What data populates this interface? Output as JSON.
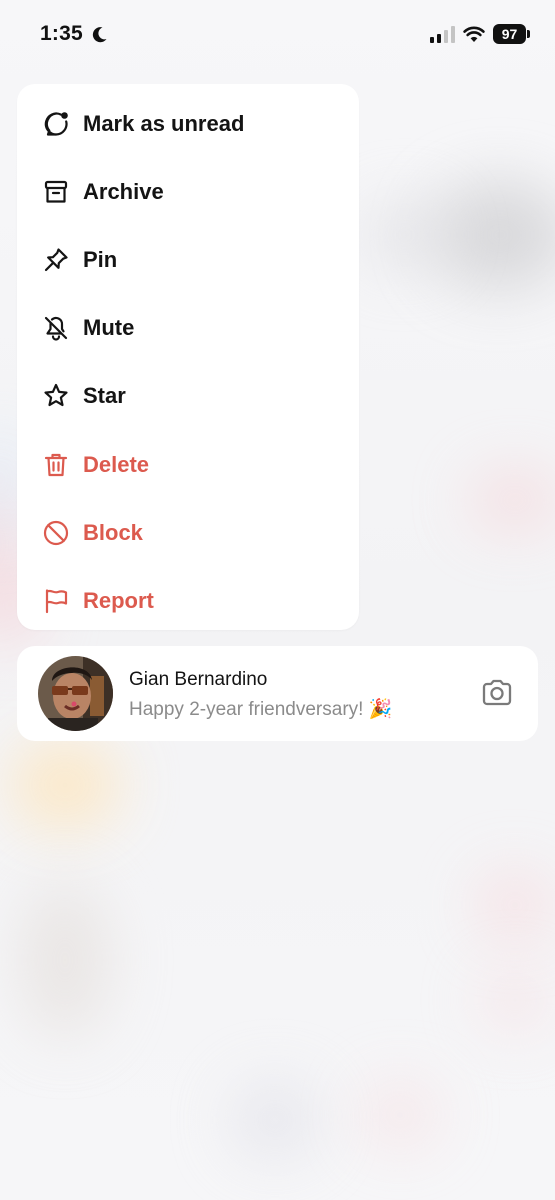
{
  "status_bar": {
    "time": "1:35",
    "battery": "97",
    "icons": [
      "moon-icon",
      "cellular-signal-icon",
      "wifi-icon",
      "battery-icon"
    ]
  },
  "menu": {
    "items": [
      {
        "label": "Mark as unread",
        "icon": "chat-bubble-dot-icon",
        "style": "normal"
      },
      {
        "label": "Archive",
        "icon": "archive-box-icon",
        "style": "normal"
      },
      {
        "label": "Pin",
        "icon": "pin-icon",
        "style": "normal"
      },
      {
        "label": "Mute",
        "icon": "bell-slash-icon",
        "style": "normal"
      },
      {
        "label": "Star",
        "icon": "star-icon",
        "style": "normal"
      },
      {
        "label": "Delete",
        "icon": "trash-icon",
        "style": "danger"
      },
      {
        "label": "Block",
        "icon": "block-icon",
        "style": "danger"
      },
      {
        "label": "Report",
        "icon": "flag-icon",
        "style": "danger"
      }
    ]
  },
  "chat": {
    "name": "Gian Bernardino",
    "message": "Happy 2-year friendversary! 🎉",
    "icon": "camera-icon"
  },
  "colors": {
    "danger": "#dc5a4e",
    "text": "#141414",
    "muted": "#8b8b8b"
  }
}
